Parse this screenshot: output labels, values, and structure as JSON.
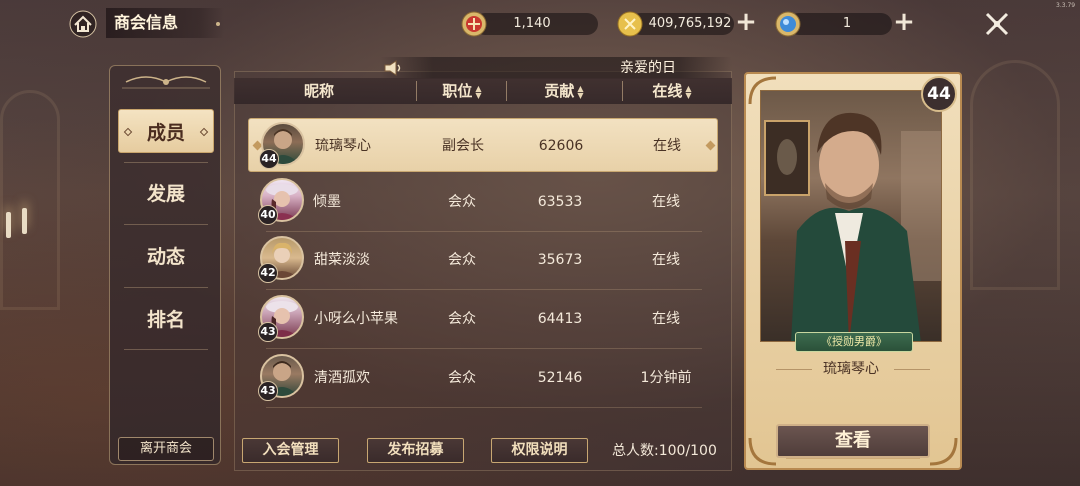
{
  "header": {
    "title": "商会信息",
    "version": "3.3.79",
    "resources": [
      {
        "name": "shield-coin",
        "value": "1,140",
        "icon": "shield-coin-icon",
        "color": "#c8382f"
      },
      {
        "name": "gold",
        "value": "409,765,192",
        "icon": "gold-coin-icon",
        "color": "#e0b43c"
      },
      {
        "name": "gem",
        "value": "1",
        "icon": "blue-gem-icon",
        "color": "#3f8bd8"
      }
    ]
  },
  "announcement": "亲爱的日",
  "nav": {
    "items": [
      {
        "label": "成员",
        "active": true
      },
      {
        "label": "发展",
        "active": false
      },
      {
        "label": "动态",
        "active": false
      },
      {
        "label": "排名",
        "active": false
      }
    ],
    "leave_label": "离开商会"
  },
  "table": {
    "columns": [
      "昵称",
      "职位",
      "贡献",
      "在线"
    ],
    "rows": [
      {
        "level": "44",
        "name": "琉璃琴心",
        "position": "副会长",
        "contribution": "62606",
        "online": "在线",
        "selected": true
      },
      {
        "level": "40",
        "name": "倾墨",
        "position": "会众",
        "contribution": "63533",
        "online": "在线",
        "selected": false
      },
      {
        "level": "42",
        "name": "甜菜淡淡",
        "position": "会众",
        "contribution": "35673",
        "online": "在线",
        "selected": false
      },
      {
        "level": "43",
        "name": "小呀么小苹果",
        "position": "会众",
        "contribution": "64413",
        "online": "在线",
        "selected": false
      },
      {
        "level": "43",
        "name": "清酒孤欢",
        "position": "会众",
        "contribution": "52146",
        "online": "1分钟前",
        "selected": false
      }
    ]
  },
  "footer": {
    "join_manage": "入会管理",
    "post_recruit": "发布招募",
    "permission_info": "权限说明",
    "total": "总人数:100/100"
  },
  "card": {
    "level": "44",
    "title_badge": "《授勋男爵》",
    "name": "琉璃琴心",
    "view_label": "查看"
  },
  "colors": {
    "accent_gold": "#c8a772",
    "selected_row": "#f2e1c1",
    "badge_green": "#2b5139"
  }
}
